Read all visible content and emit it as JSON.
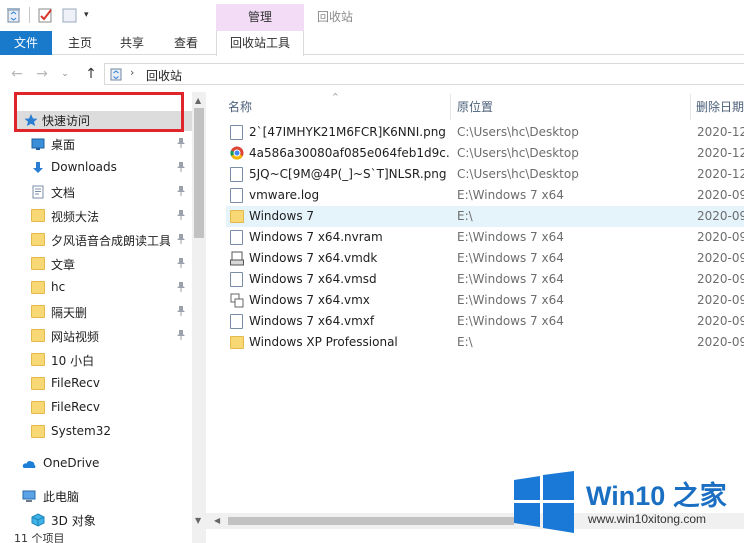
{
  "window": {
    "title": "回收站",
    "contextual_tab_header": "管理"
  },
  "quick_access_toolbar": {
    "icons": [
      "recycle-bin-icon",
      "properties-icon",
      "new-folder-icon"
    ],
    "dropdown_glyph": "▾"
  },
  "ribbon": {
    "tabs": [
      {
        "id": "file",
        "label": "文件"
      },
      {
        "id": "home",
        "label": "主页"
      },
      {
        "id": "share",
        "label": "共享"
      },
      {
        "id": "view",
        "label": "查看"
      },
      {
        "id": "recycle_tools",
        "label": "回收站工具"
      }
    ],
    "accent": "#1979ca"
  },
  "address": {
    "back_glyph": "←",
    "forward_glyph": "→",
    "recent_glyph": "⌄",
    "up_glyph": "↑",
    "separator": "›",
    "path": "回收站"
  },
  "nav_pane": {
    "quick_access": "快速访问",
    "items": [
      {
        "label": "桌面",
        "icon": "desktop-icon",
        "pinned": true
      },
      {
        "label": "Downloads",
        "icon": "downloads-icon",
        "pinned": true
      },
      {
        "label": "文档",
        "icon": "documents-icon",
        "pinned": true
      },
      {
        "label": "视频大法",
        "icon": "folder-icon",
        "pinned": true
      },
      {
        "label": "夕风语音合成朗读工具",
        "icon": "folder-icon",
        "pinned": true
      },
      {
        "label": "文章",
        "icon": "folder-icon",
        "pinned": true
      },
      {
        "label": "hc",
        "icon": "folder-icon",
        "pinned": true
      },
      {
        "label": "隔天删",
        "icon": "folder-icon",
        "pinned": true
      },
      {
        "label": "网站视频",
        "icon": "folder-icon",
        "pinned": true
      },
      {
        "label": "10 小白",
        "icon": "folder-icon",
        "pinned": false
      },
      {
        "label": "FileRecv",
        "icon": "folder-icon",
        "pinned": false
      },
      {
        "label": "FileRecv",
        "icon": "folder-icon",
        "pinned": false
      },
      {
        "label": "System32",
        "icon": "folder-icon",
        "pinned": false
      }
    ],
    "onedrive": "OneDrive",
    "this_pc": "此电脑",
    "objects_3d": "3D 对象"
  },
  "file_list": {
    "columns": {
      "name": "名称",
      "original_location": "原位置",
      "date_deleted": "删除日期"
    },
    "sort_glyph": "^",
    "rows": [
      {
        "name": "2`[47IMHYK21M6FCR]K6NNI.png",
        "original": "C:\\Users\\hc\\Desktop",
        "date": "2020-12",
        "icon": "png-file-icon",
        "selected": false
      },
      {
        "name": "4a586a30080af085e064feb1d9c...",
        "original": "C:\\Users\\hc\\Desktop",
        "date": "2020-12",
        "icon": "chrome-icon",
        "selected": false
      },
      {
        "name": "5JQ~C[9M@4P(_]~S`T]NLSR.png",
        "original": "C:\\Users\\hc\\Desktop",
        "date": "2020-12",
        "icon": "png-file-icon",
        "selected": false
      },
      {
        "name": "vmware.log",
        "original": "E:\\Windows 7 x64",
        "date": "2020-09",
        "icon": "log-file-icon",
        "selected": false
      },
      {
        "name": "Windows 7",
        "original": "E:\\",
        "date": "2020-09",
        "icon": "folder-icon",
        "selected": true
      },
      {
        "name": "Windows 7 x64.nvram",
        "original": "E:\\Windows 7 x64",
        "date": "2020-09",
        "icon": "nvram-file-icon",
        "selected": false
      },
      {
        "name": "Windows 7 x64.vmdk",
        "original": "E:\\Windows 7 x64",
        "date": "2020-09",
        "icon": "vmdk-file-icon",
        "selected": false
      },
      {
        "name": "Windows 7 x64.vmsd",
        "original": "E:\\Windows 7 x64",
        "date": "2020-09",
        "icon": "vmsd-file-icon",
        "selected": false
      },
      {
        "name": "Windows 7 x64.vmx",
        "original": "E:\\Windows 7 x64",
        "date": "2020-09",
        "icon": "vmx-file-icon",
        "selected": false
      },
      {
        "name": "Windows 7 x64.vmxf",
        "original": "E:\\Windows 7 x64",
        "date": "2020-09",
        "icon": "vmxf-file-icon",
        "selected": false
      },
      {
        "name": "Windows XP Professional",
        "original": "E:\\",
        "date": "2020-09",
        "icon": "folder-icon",
        "selected": false
      }
    ]
  },
  "status": {
    "item_count": "11 个项目"
  },
  "watermark": {
    "brand": "Win10 之家",
    "url": "www.win10xitong.com",
    "color": "#1a6fc2"
  },
  "colors": {
    "highlight_box": "#e0242b",
    "selection": "#e5f3fb",
    "contextual_tab": "#f2dcf6"
  }
}
